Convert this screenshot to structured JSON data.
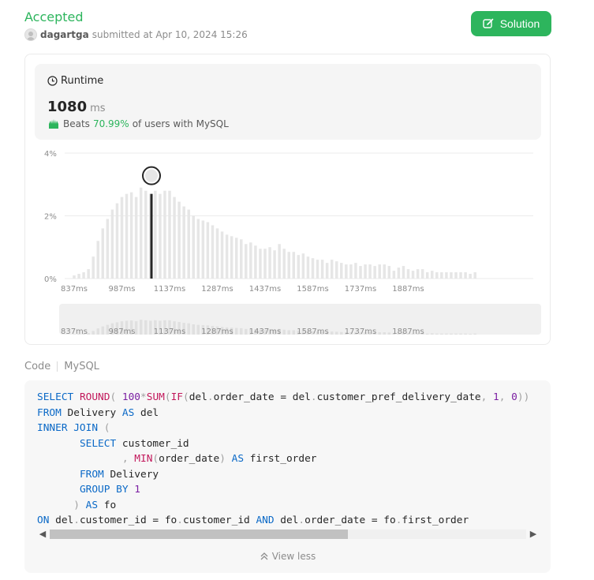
{
  "submission": {
    "status": "Accepted",
    "user": "dagartga",
    "submitted_text": "submitted at Apr 10, 2024 15:26",
    "solution_label": "Solution"
  },
  "runtime": {
    "title": "Runtime",
    "value": "1080",
    "unit": "ms",
    "beats_prefix": "Beats",
    "beats_pct": "70.99%",
    "beats_suffix": "of users with MySQL"
  },
  "chart_data": {
    "type": "bar",
    "title": "",
    "xlabel": "",
    "ylabel": "",
    "x_ticks": [
      "837ms",
      "987ms",
      "1137ms",
      "1287ms",
      "1437ms",
      "1587ms",
      "1737ms",
      "1887ms"
    ],
    "y_ticks": [
      "4%",
      "2%",
      "0%"
    ],
    "ylim": [
      0,
      4
    ],
    "x_start": 837,
    "x_step": 15,
    "highlight_x": 1080,
    "values": [
      0.1,
      0.15,
      0.2,
      0.3,
      0.7,
      1.2,
      1.6,
      1.9,
      2.2,
      2.4,
      2.6,
      2.7,
      2.75,
      2.6,
      2.9,
      2.8,
      2.7,
      2.8,
      2.7,
      2.8,
      2.8,
      2.6,
      2.45,
      2.3,
      2.2,
      2.0,
      1.9,
      1.85,
      1.8,
      1.7,
      1.6,
      1.5,
      1.4,
      1.35,
      1.3,
      1.25,
      1.1,
      1.15,
      1.05,
      0.95,
      0.95,
      1.0,
      0.9,
      1.1,
      0.95,
      0.85,
      0.85,
      0.75,
      0.8,
      0.7,
      0.65,
      0.6,
      0.6,
      0.5,
      0.6,
      0.55,
      0.5,
      0.45,
      0.45,
      0.5,
      0.4,
      0.45,
      0.45,
      0.4,
      0.45,
      0.45,
      0.4,
      0.25,
      0.35,
      0.4,
      0.3,
      0.25,
      0.3,
      0.3,
      0.2,
      0.25,
      0.2,
      0.2,
      0.2,
      0.2,
      0.2,
      0.2,
      0.2,
      0.15,
      0.2
    ],
    "overview_ticks": [
      "837ms",
      "987ms",
      "1137ms",
      "1287ms",
      "1437ms",
      "1587ms",
      "1737ms",
      "1887ms"
    ]
  },
  "code": {
    "tab_code": "Code",
    "tab_lang": "MySQL",
    "lines": [
      [
        {
          "t": "SELECT ",
          "c": "kw"
        },
        {
          "t": "ROUND",
          "c": "fn"
        },
        {
          "t": "( ",
          "c": "op"
        },
        {
          "t": "100",
          "c": "num"
        },
        {
          "t": "*",
          "c": "op"
        },
        {
          "t": "SUM",
          "c": "fn"
        },
        {
          "t": "(",
          "c": "op"
        },
        {
          "t": "IF",
          "c": "fn"
        },
        {
          "t": "(",
          "c": "op"
        },
        {
          "t": "del",
          "c": ""
        },
        {
          "t": ".",
          "c": "op"
        },
        {
          "t": "order_date ",
          "c": ""
        },
        {
          "t": "= ",
          "c": ""
        },
        {
          "t": "del",
          "c": ""
        },
        {
          "t": ".",
          "c": "op"
        },
        {
          "t": "customer_pref_delivery_date",
          "c": ""
        },
        {
          "t": ", ",
          "c": "op"
        },
        {
          "t": "1",
          "c": "num"
        },
        {
          "t": ", ",
          "c": "op"
        },
        {
          "t": "0",
          "c": "num"
        },
        {
          "t": "))",
          "c": "op"
        }
      ],
      [
        {
          "t": "FROM ",
          "c": "kw"
        },
        {
          "t": "Delivery ",
          "c": ""
        },
        {
          "t": "AS ",
          "c": "kw"
        },
        {
          "t": "del",
          "c": ""
        }
      ],
      [
        {
          "t": "INNER JOIN ",
          "c": "kw"
        },
        {
          "t": "(",
          "c": "op"
        }
      ],
      [
        {
          "t": "       ",
          "c": ""
        },
        {
          "t": "SELECT ",
          "c": "kw"
        },
        {
          "t": "customer_id",
          "c": ""
        }
      ],
      [
        {
          "t": "              ",
          "c": ""
        },
        {
          "t": ", ",
          "c": "op"
        },
        {
          "t": "MIN",
          "c": "fn"
        },
        {
          "t": "(",
          "c": "op"
        },
        {
          "t": "order_date",
          "c": ""
        },
        {
          "t": ") ",
          "c": "op"
        },
        {
          "t": "AS ",
          "c": "kw"
        },
        {
          "t": "first_order",
          "c": ""
        }
      ],
      [
        {
          "t": "       ",
          "c": ""
        },
        {
          "t": "FROM ",
          "c": "kw"
        },
        {
          "t": "Delivery",
          "c": ""
        }
      ],
      [
        {
          "t": "       ",
          "c": ""
        },
        {
          "t": "GROUP BY ",
          "c": "kw"
        },
        {
          "t": "1",
          "c": "num"
        }
      ],
      [
        {
          "t": "      ",
          "c": ""
        },
        {
          "t": ") ",
          "c": "op"
        },
        {
          "t": "AS ",
          "c": "kw"
        },
        {
          "t": "fo",
          "c": ""
        }
      ],
      [
        {
          "t": "ON ",
          "c": "kw"
        },
        {
          "t": "del",
          "c": ""
        },
        {
          "t": ".",
          "c": "op"
        },
        {
          "t": "customer_id ",
          "c": ""
        },
        {
          "t": "= ",
          "c": ""
        },
        {
          "t": "fo",
          "c": ""
        },
        {
          "t": ".",
          "c": "op"
        },
        {
          "t": "customer_id ",
          "c": ""
        },
        {
          "t": "AND ",
          "c": "kw"
        },
        {
          "t": "del",
          "c": ""
        },
        {
          "t": ".",
          "c": "op"
        },
        {
          "t": "order_date ",
          "c": ""
        },
        {
          "t": "= ",
          "c": ""
        },
        {
          "t": "fo",
          "c": ""
        },
        {
          "t": ".",
          "c": "op"
        },
        {
          "t": "first_order",
          "c": ""
        }
      ]
    ],
    "view_less_label": "View less"
  },
  "colors": {
    "accent_green": "#2db55d",
    "bar_default": "#e6e6e6",
    "bar_highlight": "#262626"
  }
}
